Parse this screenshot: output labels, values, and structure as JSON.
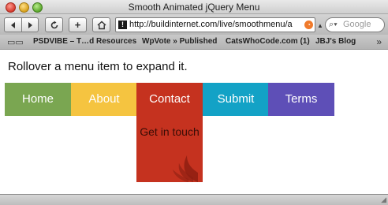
{
  "window": {
    "title": "Smooth Animated jQuery Menu"
  },
  "toolbar": {
    "back_icon": "back-arrow-icon",
    "forward_icon": "forward-arrow-icon",
    "reload_icon": "reload-icon",
    "add_label": "+",
    "home_icon": "home-icon",
    "url": "http://buildinternet.com/live/smoothmenu/a",
    "search_placeholder": "Google"
  },
  "bookmarks": {
    "items": [
      "PSDVIBE – T…d Resources",
      "WpVote » Published",
      "CatsWhoCode.com (1)",
      "JBJ's Blog"
    ],
    "more": "»"
  },
  "page": {
    "instruction": "Rollover a menu item to expand it.",
    "menu": [
      {
        "label": "Home",
        "color": "#7aa651"
      },
      {
        "label": "About",
        "color": "#f5c440"
      },
      {
        "label": "Contact",
        "color": "#c5321f"
      },
      {
        "label": "Submit",
        "color": "#13a2c6"
      },
      {
        "label": "Terms",
        "color": "#5e4fb7"
      }
    ],
    "contact_expanded": {
      "text": "Get in touch"
    }
  }
}
